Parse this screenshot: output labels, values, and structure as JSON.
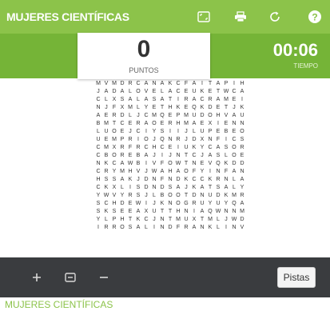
{
  "header": {
    "title": "MUJERES CIENTÍFICAS",
    "buttons": [
      "fullscreen-icon",
      "print-icon",
      "restart-icon",
      "help-icon"
    ]
  },
  "score": {
    "value": "0",
    "label": "PUNTOS"
  },
  "timer": {
    "value": "00:06",
    "label": "TIEMPO"
  },
  "grid": [
    "MVMDRCANAKCFAITAPIH",
    "JADALOVELACEUKETWCA",
    "CLXSALASATIRACRAMEI",
    "NJFXMLYETHKEQKDETJK",
    "AERDLJCMQEPMUDOHVAU",
    "BMTCERAOERHMAEXIENN",
    "LUOEJCIYSIIJLUPEBEO",
    "UEMPRIOJQNRJDXNFICS",
    "CMXRFRCHCEIUKYCASOR",
    "CBOREBAJIJNTCJASLOE",
    "NKCAWBIVFOWTNEVQKDD",
    "CRYMHVJWAHAOFYINFAN",
    "HSSAKJDNFNDKCCKRNLA",
    "CKXLISDNDSAJKATSALY",
    "YWVYRSJLBOOTDNUDKMR",
    "SCHDEWIJKNOGRUYUYQA",
    "SKSEEAXUTTHNIAQWNNM",
    "YLPHTKCJNTMUXTMLJWD",
    "IRROSALINDFRANKLINV"
  ],
  "toolbar": {
    "zoom_in_icon": "plus-icon",
    "zoom_fit_icon": "fit-icon",
    "zoom_out_icon": "minus-icon",
    "hints_label": "Pistas"
  },
  "footer": {
    "title": "MUJERES CIENTÍFICAS"
  },
  "colors": {
    "header_green": "#8cc34a",
    "scorebar_green": "#75b437",
    "bottombar": "#3a3c3f",
    "footer_text": "#8cc34a"
  }
}
